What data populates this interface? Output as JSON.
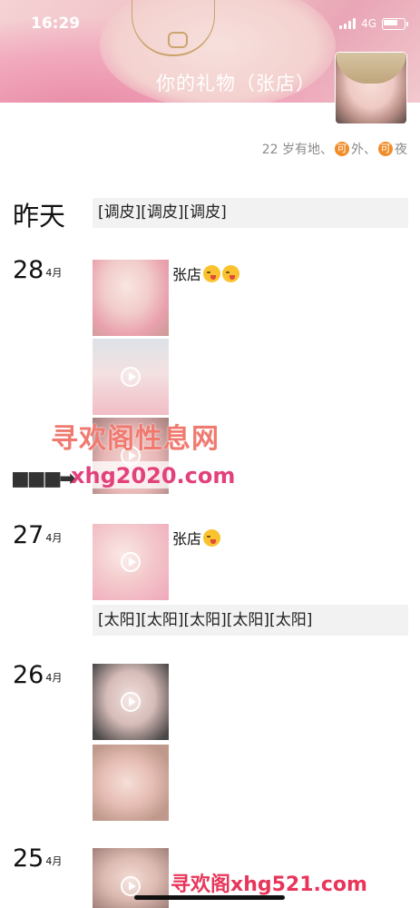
{
  "status_bar": {
    "time": "16:29",
    "network": "4G"
  },
  "header": {
    "title": "你的礼物（张店）",
    "subtitle_pre": "22 岁有地、",
    "badge": "可",
    "subtitle_mid": "外、",
    "subtitle_end": "夜"
  },
  "feed": [
    {
      "date": "昨天",
      "text": "[调皮][调皮][调皮]"
    },
    {
      "day": "28",
      "month": "4月",
      "caption": "张店",
      "thumbs": 3
    },
    {
      "day": "27",
      "month": "4月",
      "caption": "张店",
      "text": "[太阳][太阳][太阳][太阳][太阳]"
    },
    {
      "day": "26",
      "month": "4月"
    },
    {
      "day": "25",
      "month": "4月"
    }
  ],
  "watermark": {
    "line1": "寻欢阁性息网",
    "line2": "xhg2020.com",
    "line3": "寻欢阁xhg521.com"
  },
  "colors": {
    "badge": "#f08d2a",
    "text_card_bg": "#f2f2f2",
    "subtitle": "#8a8a8a"
  }
}
